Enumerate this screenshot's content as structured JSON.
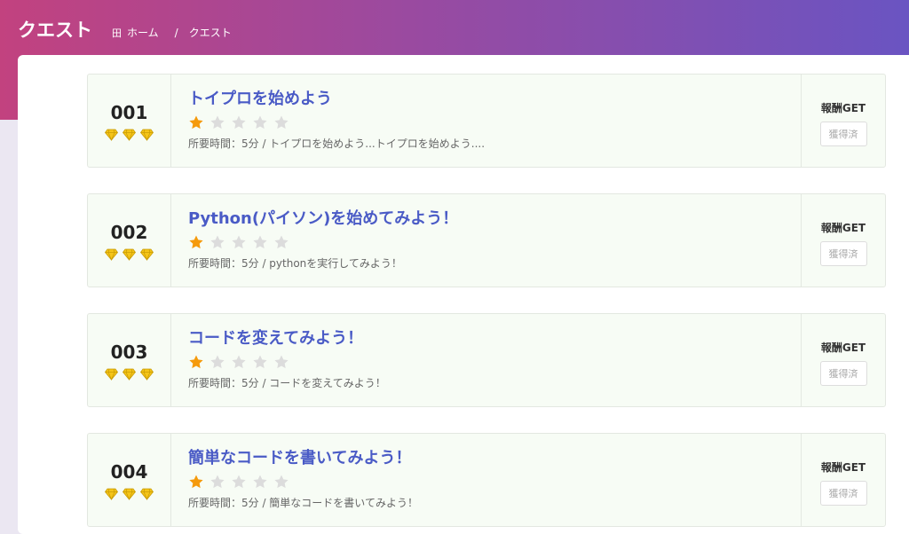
{
  "header": {
    "title": "クエスト",
    "breadcrumb_home_icon": "home-grid-icon",
    "breadcrumb_home": "ホーム",
    "breadcrumb_sep": "/",
    "breadcrumb_current": "クエスト"
  },
  "colors": {
    "gradient_start": "#c2427f",
    "gradient_end": "#6a54c2",
    "title_link": "#4a5bc6",
    "star_active": "#f59a0c",
    "star_inactive": "#dcdcdc",
    "gem": "#f5c518",
    "card_bg": "#f7fcf5"
  },
  "quests": [
    {
      "number": "001",
      "gems": 3,
      "title": "トイプロを始めよう",
      "difficulty": 1,
      "difficulty_max": 5,
      "description": "所要時間：5分 / トイプロを始めよう...トイプロを始めよう....",
      "reward_label": "報酬GET",
      "reward_button": "獲得済"
    },
    {
      "number": "002",
      "gems": 3,
      "title": "Python(パイソン)を始めてみよう！",
      "difficulty": 1,
      "difficulty_max": 5,
      "description": "所要時間：5分 / pythonを実行してみよう！",
      "reward_label": "報酬GET",
      "reward_button": "獲得済"
    },
    {
      "number": "003",
      "gems": 3,
      "title": "コードを変えてみよう！",
      "difficulty": 1,
      "difficulty_max": 5,
      "description": "所要時間：5分 / コードを変えてみよう！",
      "reward_label": "報酬GET",
      "reward_button": "獲得済"
    },
    {
      "number": "004",
      "gems": 3,
      "title": "簡単なコードを書いてみよう！",
      "difficulty": 1,
      "difficulty_max": 5,
      "description": "所要時間：5分 / 簡単なコードを書いてみよう！",
      "reward_label": "報酬GET",
      "reward_button": "獲得済"
    }
  ]
}
